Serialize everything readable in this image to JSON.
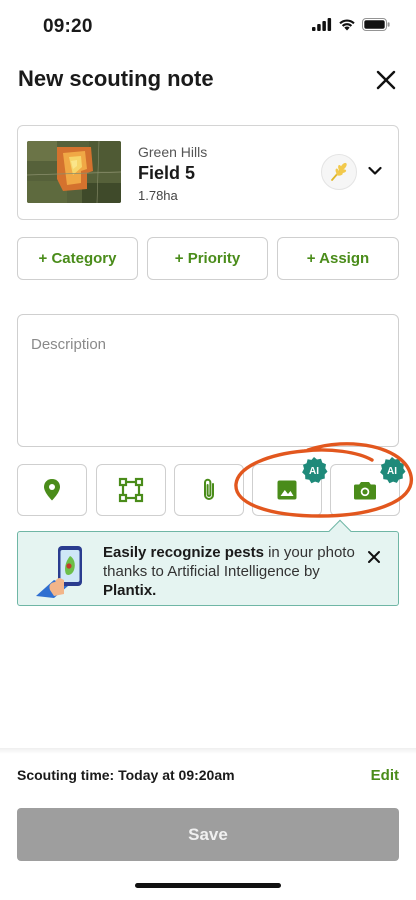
{
  "status_bar": {
    "time": "09:20"
  },
  "header": {
    "title": "New scouting note"
  },
  "field": {
    "farm": "Green Hills",
    "name": "Field 5",
    "area": "1.78ha"
  },
  "chips": [
    {
      "label": "+ Category"
    },
    {
      "label": "+ Priority"
    },
    {
      "label": "+ Assign"
    }
  ],
  "description": {
    "placeholder": "Description"
  },
  "tools": [
    {
      "icon": "location-pin-icon"
    },
    {
      "icon": "draw-area-icon"
    },
    {
      "icon": "attachment-icon"
    },
    {
      "icon": "image-icon",
      "badge": "AI"
    },
    {
      "icon": "camera-icon",
      "badge": "AI"
    }
  ],
  "tip": {
    "bold1": "Easily recognize pests",
    "text1": " in your photo thanks to Artificial Intelligence by ",
    "bold2": "Plantix."
  },
  "footer": {
    "scouting_time": "Scouting time: Today at 09:20am",
    "edit_label": "Edit",
    "save_label": "Save"
  },
  "colors": {
    "accent_green": "#4a8c1a",
    "ai_badge_teal": "#1f8a7a",
    "annotation_orange": "#e2571e",
    "save_disabled": "#9e9e9e"
  }
}
